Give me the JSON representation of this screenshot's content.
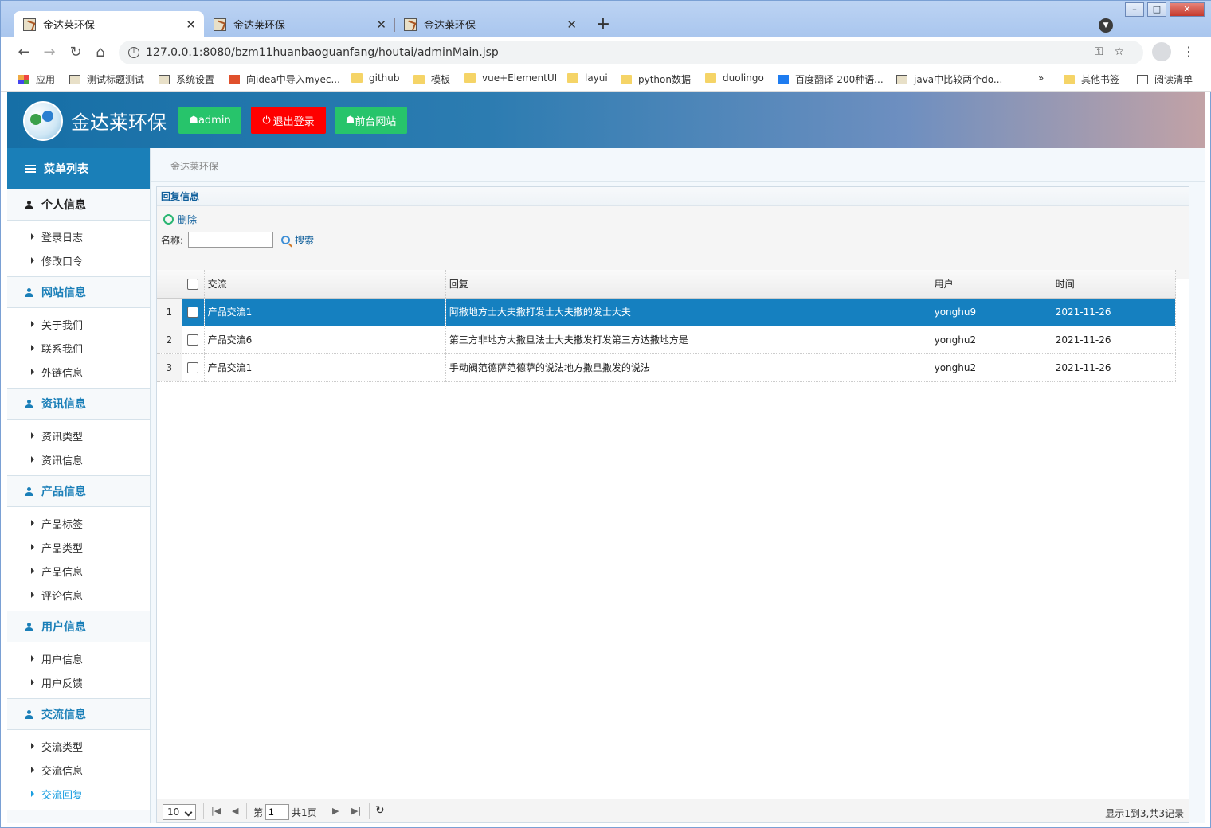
{
  "browser": {
    "tabs": [
      {
        "title": "金达莱环保"
      },
      {
        "title": "金达莱环保"
      },
      {
        "title": "金达莱环保"
      }
    ],
    "url": "127.0.0.1:8080/bzm11huanbaoguanfang/houtai/adminMain.jsp",
    "bookmarks": [
      {
        "label": "应用",
        "icon": "apps-grid-icon"
      },
      {
        "label": "测试标题测试",
        "icon": "page-icon"
      },
      {
        "label": "系统设置",
        "icon": "page-icon"
      },
      {
        "label": "向idea中导入myec...",
        "icon": "c-icon"
      },
      {
        "label": "github",
        "icon": "folder-icon"
      },
      {
        "label": "模板",
        "icon": "folder-icon"
      },
      {
        "label": "vue+ElementUI",
        "icon": "folder-icon"
      },
      {
        "label": "layui",
        "icon": "folder-icon"
      },
      {
        "label": "python数据",
        "icon": "folder-icon"
      },
      {
        "label": "duolingo",
        "icon": "folder-icon"
      },
      {
        "label": "百度翻译-200种语...",
        "icon": "translate-icon"
      },
      {
        "label": "java中比较两个do...",
        "icon": "page-icon"
      }
    ],
    "more_label": "»",
    "other_bookmarks": "其他书签",
    "reading_list": "阅读清单"
  },
  "header": {
    "brand": "金达莱环保",
    "admin_btn": "admin",
    "logout_btn": "退出登录",
    "front_btn": "前台网站",
    "colors": {
      "admin": "#27c46b",
      "logout": "#ff0000",
      "front": "#27c46b"
    }
  },
  "sidebar": {
    "title": "菜单列表",
    "groups": [
      {
        "label": "个人信息",
        "items": [
          "登录日志",
          "修改口令"
        ]
      },
      {
        "label": "网站信息",
        "items": [
          "关于我们",
          "联系我们",
          "外链信息"
        ]
      },
      {
        "label": "资讯信息",
        "items": [
          "资讯类型",
          "资讯信息"
        ]
      },
      {
        "label": "产品信息",
        "items": [
          "产品标签",
          "产品类型",
          "产品信息",
          "评论信息"
        ]
      },
      {
        "label": "用户信息",
        "items": [
          "用户信息",
          "用户反馈"
        ]
      },
      {
        "label": "交流信息",
        "items": [
          "交流类型",
          "交流信息",
          "交流回复"
        ]
      }
    ],
    "active_item": "交流回复"
  },
  "breadcrumb": "金达莱环保",
  "panel": {
    "title": "回复信息",
    "delete_label": "删除",
    "name_label": "名称:",
    "name_value": "",
    "search_label": "搜索",
    "columns": [
      "交流",
      "回复",
      "用户",
      "时间"
    ],
    "rows": [
      {
        "n": "1",
        "jiaoliu": "产品交流1",
        "huifu": "阿撒地方士大夫撒打发士大夫撒的发士大夫",
        "user": "yonghu9",
        "time": "2021-11-26",
        "selected": true
      },
      {
        "n": "2",
        "jiaoliu": "产品交流6",
        "huifu": "第三方非地方大撒旦法士大夫撒发打发第三方达撒地方是",
        "user": "yonghu2",
        "time": "2021-11-26",
        "selected": false
      },
      {
        "n": "3",
        "jiaoliu": "产品交流1",
        "huifu": "手动阀范德萨范德萨的说法地方撒旦撒发的说法",
        "user": "yonghu2",
        "time": "2021-11-26",
        "selected": false
      }
    ]
  },
  "pager": {
    "page_size": "10",
    "page_prefix": "第",
    "page_value": "1",
    "page_total": "共1页",
    "info": "显示1到3,共3记录"
  }
}
